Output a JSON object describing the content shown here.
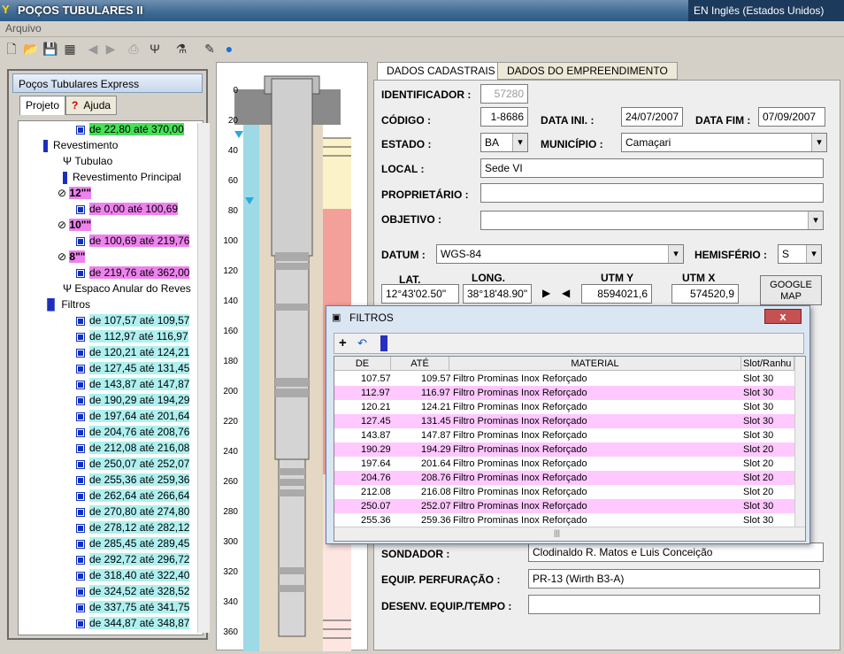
{
  "window": {
    "title": "POÇOS TUBULARES II",
    "ime": "EN Inglês (Estados Unidos)"
  },
  "menu": {
    "arquivo": "Arquivo"
  },
  "left": {
    "panel_title": "Poços Tubulares Express",
    "tab_projeto": "Projeto",
    "tab_ajuda": "Ajuda",
    "tree": [
      {
        "text": "de 22,80 até 370,00",
        "style": "g",
        "level": 3,
        "icon": "dot"
      },
      {
        "text": "Revestimento",
        "style": "",
        "level": 1,
        "icon": "bar"
      },
      {
        "text": "Tubulao",
        "style": "",
        "level": 2,
        "icon": "tube"
      },
      {
        "text": "Revestimento Principal",
        "style": "",
        "level": 2,
        "icon": "bar"
      },
      {
        "text": "12\"\"",
        "style": "p",
        "level": 2,
        "icon": "ring"
      },
      {
        "text": "de 0,00 até 100,69",
        "style": "p",
        "level": 3,
        "icon": "dot"
      },
      {
        "text": "10\"\"",
        "style": "p",
        "level": 2,
        "icon": "ring"
      },
      {
        "text": "de 100,69 até 219,76",
        "style": "p",
        "level": 3,
        "icon": "dot"
      },
      {
        "text": "8\"\"",
        "style": "p",
        "level": 2,
        "icon": "ring"
      },
      {
        "text": "de 219,76 até 362,00",
        "style": "p",
        "level": 3,
        "icon": "dot"
      },
      {
        "text": "Espaco Anular do Reves",
        "style": "",
        "level": 2,
        "icon": "tube"
      },
      {
        "text": "Filtros",
        "style": "",
        "level": 1,
        "icon": "bars"
      },
      {
        "text": "de 107,57 até 109,57",
        "style": "c",
        "level": 3,
        "icon": "dot"
      },
      {
        "text": "de 112,97 até 116,97",
        "style": "c",
        "level": 3,
        "icon": "dot"
      },
      {
        "text": "de 120,21 até 124,21",
        "style": "c",
        "level": 3,
        "icon": "dot"
      },
      {
        "text": "de 127,45 até 131,45",
        "style": "c",
        "level": 3,
        "icon": "dot"
      },
      {
        "text": "de 143,87 até 147,87",
        "style": "c",
        "level": 3,
        "icon": "dot"
      },
      {
        "text": "de 190,29 até 194,29",
        "style": "c",
        "level": 3,
        "icon": "dot"
      },
      {
        "text": "de 197,64 até 201,64",
        "style": "c",
        "level": 3,
        "icon": "dot"
      },
      {
        "text": "de 204,76 até 208,76",
        "style": "c",
        "level": 3,
        "icon": "dot"
      },
      {
        "text": "de 212,08 até 216,08",
        "style": "c",
        "level": 3,
        "icon": "dot"
      },
      {
        "text": "de 250,07 até 252,07",
        "style": "c",
        "level": 3,
        "icon": "dot"
      },
      {
        "text": "de 255,36 até 259,36",
        "style": "c",
        "level": 3,
        "icon": "dot"
      },
      {
        "text": "de 262,64 até 266,64",
        "style": "c",
        "level": 3,
        "icon": "dot"
      },
      {
        "text": "de 270,80 até 274,80",
        "style": "c",
        "level": 3,
        "icon": "dot"
      },
      {
        "text": "de 278,12 até 282,12",
        "style": "c",
        "level": 3,
        "icon": "dot"
      },
      {
        "text": "de 285,45 até 289,45",
        "style": "c",
        "level": 3,
        "icon": "dot"
      },
      {
        "text": "de 292,72 até 296,72",
        "style": "c",
        "level": 3,
        "icon": "dot"
      },
      {
        "text": "de 318,40 até 322,40",
        "style": "c",
        "level": 3,
        "icon": "dot"
      },
      {
        "text": "de 324,52 até 328,52",
        "style": "c",
        "level": 3,
        "icon": "dot"
      },
      {
        "text": "de 337,75 até 341,75",
        "style": "c",
        "level": 3,
        "icon": "dot"
      },
      {
        "text": "de 344,87 até 348,87",
        "style": "c",
        "level": 3,
        "icon": "dot"
      }
    ]
  },
  "well": {
    "depth_ticks": [
      "0",
      "20",
      "40",
      "60",
      "80",
      "100",
      "120",
      "140",
      "160",
      "180",
      "200",
      "220",
      "240",
      "260",
      "280",
      "300",
      "320",
      "340",
      "360"
    ]
  },
  "form": {
    "tab_cadastrais": "DADOS CADASTRAIS",
    "tab_empreendimento": "DADOS DO EMPREENDIMENTO",
    "identificador_label": "IDENTIFICADOR :",
    "identificador": "57280",
    "codigo_label": "CÓDIGO :",
    "codigo": "1-8686",
    "data_ini_label": "DATA INI. :",
    "data_ini": "24/07/2007",
    "data_fim_label": "DATA FIM :",
    "data_fim": "07/09/2007",
    "estado_label": "ESTADO :",
    "estado": "BA",
    "municipio_label": "MUNICÍPIO :",
    "municipio": "Camaçari",
    "local_label": "LOCAL :",
    "local": "Sede VI",
    "proprietario_label": "PROPRIETÁRIO :",
    "proprietario": "",
    "objetivo_label": "OBJETIVO :",
    "objetivo": "",
    "datum_label": "DATUM :",
    "datum": "WGS-84",
    "hemisferio_label": "HEMISFÉRIO :",
    "hemisferio": "S",
    "lat_label": "LAT.",
    "lat": "12°43'02.50\"",
    "long_label": "LONG.",
    "long": "38°18'48.90\"",
    "utmy_label": "UTM Y",
    "utmy": "8594021,6",
    "utmx_label": "UTM X",
    "utmx": "574520,9",
    "google_map": "GOOGLE MAP",
    "sondador_label": "SONDADOR :",
    "sondador": "Clodinaldo R. Matos e Luis Conceição",
    "equip_label": "EQUIP. PERFURAÇÃO :",
    "equip": "PR-13 (Wirth B3-A)",
    "desenv_label": "DESENV. EQUIP./TEMPO :",
    "desenv": ""
  },
  "dialog": {
    "title": "FILTROS",
    "close": "x",
    "columns": {
      "de": "DE",
      "ate": "ATÉ",
      "material": "MATERIAL",
      "slot": "Slot/Ranhu"
    },
    "rows": [
      {
        "de": "107.57",
        "ate": "109.57",
        "material": "Filtro Prominas Inox Reforçado",
        "slot": "Slot 30"
      },
      {
        "de": "112.97",
        "ate": "116.97",
        "material": "Filtro Prominas Inox Reforçado",
        "slot": "Slot 30"
      },
      {
        "de": "120.21",
        "ate": "124.21",
        "material": "Filtro Prominas Inox Reforçado",
        "slot": "Slot 30"
      },
      {
        "de": "127.45",
        "ate": "131.45",
        "material": "Filtro Prominas Inox Reforçado",
        "slot": "Slot 30"
      },
      {
        "de": "143.87",
        "ate": "147.87",
        "material": "Filtro Prominas Inox Reforçado",
        "slot": "Slot 30"
      },
      {
        "de": "190.29",
        "ate": "194.29",
        "material": "Filtro Prominas Inox Reforçado",
        "slot": "Slot 20"
      },
      {
        "de": "197.64",
        "ate": "201.64",
        "material": "Filtro Prominas Inox Reforçado",
        "slot": "Slot 20"
      },
      {
        "de": "204.76",
        "ate": "208.76",
        "material": "Filtro Prominas Inox Reforçado",
        "slot": "Slot 20"
      },
      {
        "de": "212.08",
        "ate": "216.08",
        "material": "Filtro Prominas Inox Reforçado",
        "slot": "Slot 20"
      },
      {
        "de": "250.07",
        "ate": "252.07",
        "material": "Filtro Prominas Inox Reforçado",
        "slot": "Slot 30"
      },
      {
        "de": "255.36",
        "ate": "259.36",
        "material": "Filtro Prominas Inox Reforçado",
        "slot": "Slot 30"
      }
    ]
  }
}
